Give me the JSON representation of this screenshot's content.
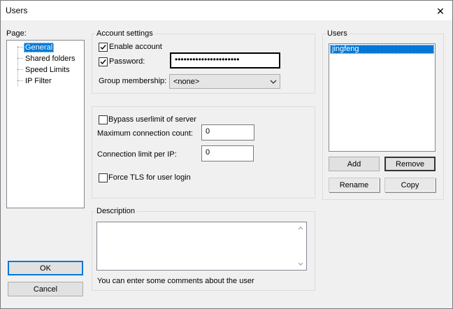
{
  "window": {
    "title": "Users",
    "close_glyph": "✕"
  },
  "page_panel": {
    "label": "Page:",
    "items": [
      "General",
      "Shared folders",
      "Speed Limits",
      "IP Filter"
    ],
    "selected_index": 0
  },
  "account_settings": {
    "legend": "Account settings",
    "enable_account": {
      "label": "Enable account",
      "checked": true
    },
    "password": {
      "label": "Password:",
      "checked": true,
      "value": "••••••••••••••••••••••"
    },
    "group_membership": {
      "label": "Group membership:",
      "value": "<none>"
    }
  },
  "limits": {
    "bypass": {
      "label": "Bypass userlimit of server",
      "checked": false
    },
    "max_connections": {
      "label": "Maximum connection count:",
      "value": "0"
    },
    "per_ip": {
      "label": "Connection limit per IP:",
      "value": "0"
    },
    "force_tls": {
      "label": "Force TLS for user login",
      "checked": false
    }
  },
  "description": {
    "legend": "Description",
    "value": "",
    "hint": "You can enter some comments about the user"
  },
  "users": {
    "legend": "Users",
    "list": [
      "jingfeng"
    ],
    "selected": "jingfeng",
    "buttons": {
      "add": "Add",
      "remove": "Remove",
      "rename": "Rename",
      "copy": "Copy"
    }
  },
  "footer": {
    "ok": "OK",
    "cancel": "Cancel"
  },
  "colors": {
    "selection": "#0078d7",
    "default_border": "#0078d7"
  },
  "icons": [
    "close-icon",
    "checkbox-check-icon",
    "chevron-down-icon",
    "scroll-up-icon",
    "scroll-down-icon"
  ]
}
